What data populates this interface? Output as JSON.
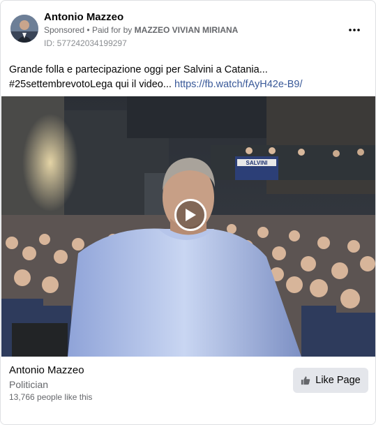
{
  "post": {
    "author_name": "Antonio Mazzeo",
    "sponsored_label": "Sponsored",
    "separator": "•",
    "paid_for_prefix": "Paid for by",
    "paid_for_by": "MAZZEO VIVIAN MIRIANA",
    "ad_id": "ID: 577242034199297",
    "body_text": "Grande folla e partecipazione oggi per Salvini a Catania... #25settembrevotoLega qui il video...",
    "link_text": "https://fb.watch/fAyH42e-B9/",
    "banner_text": "SALVINI",
    "icons": {
      "avatar": "avatar-photo",
      "more": "more-options-icon",
      "play": "play-icon",
      "like": "thumbs-up-icon"
    }
  },
  "page_card": {
    "name": "Antonio Mazzeo",
    "category": "Politician",
    "likes": "13,766 people like this",
    "like_button_label": "Like Page"
  },
  "colors": {
    "link": "#385898",
    "secondary_text": "#65676b",
    "button_bg": "#e4e6eb"
  }
}
